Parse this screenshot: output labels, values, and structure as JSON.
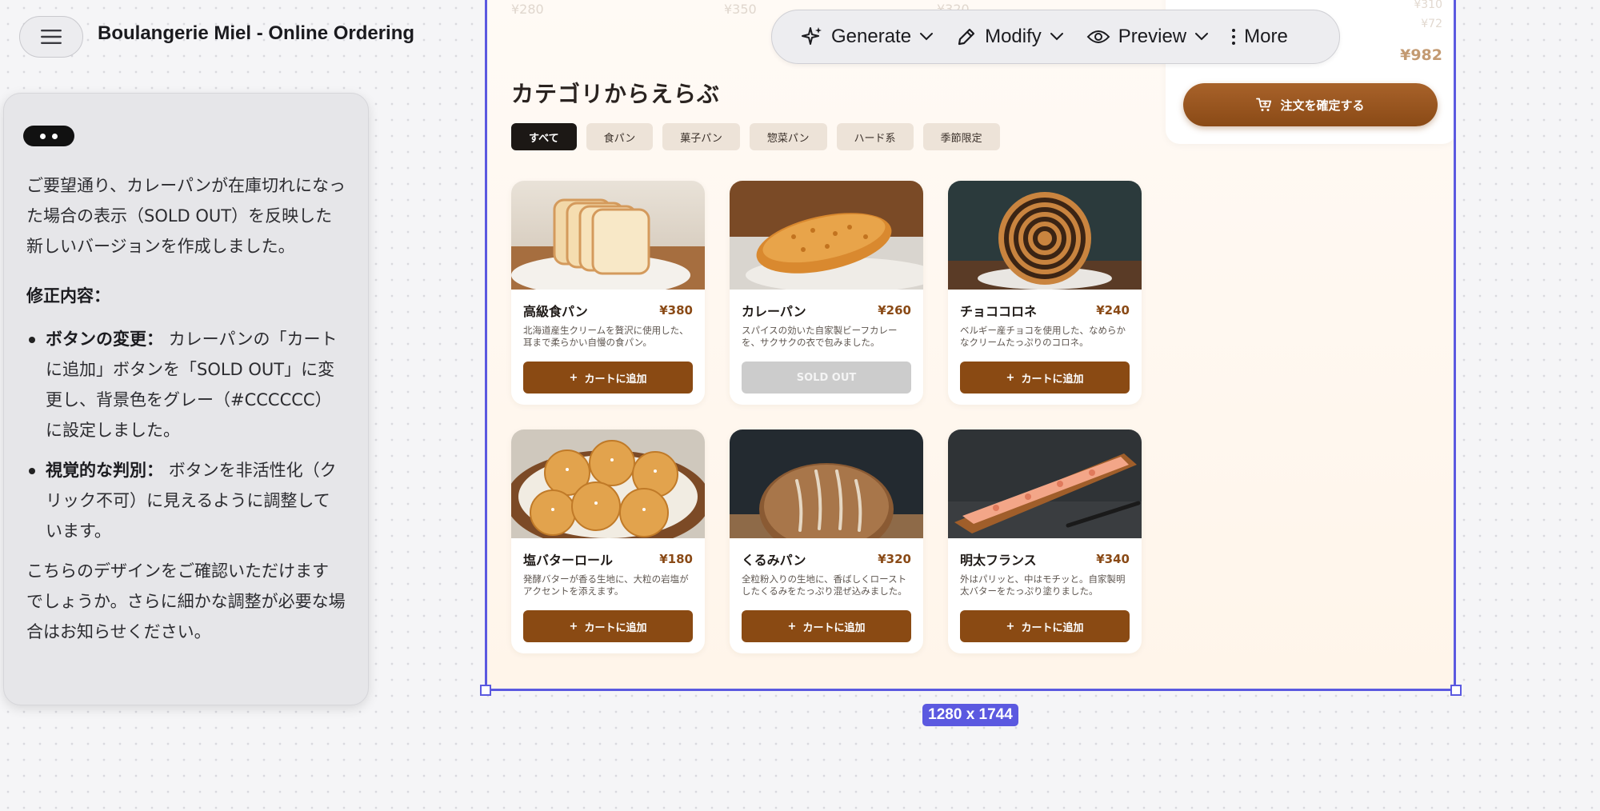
{
  "app": {
    "title": "Boulangerie Miel - Online Ordering"
  },
  "chat": {
    "intro": "ご要望通り、カレーパンが在庫切れになった場合の表示（SOLD OUT）を反映した新しいバージョンを作成しました。",
    "heading": "修正内容：",
    "bullets": [
      {
        "title": "ボタンの変更：",
        "text": "カレーパンの「カートに追加」ボタンを「SOLD OUT」に変更し、背景色をグレー（#CCCCCC）に設定しました。"
      },
      {
        "title": "視覚的な判別：",
        "text": "ボタンを非活性化（クリック不可）に見えるように調整しています。"
      }
    ],
    "closing": "こちらのデザインをご確認いただけますでしょうか。さらに細かな調整が必要な場合はお知らせください。"
  },
  "toolbar": {
    "generate": "Generate",
    "modify": "Modify",
    "preview": "Preview",
    "more": "More"
  },
  "frame": {
    "size_label": "1280 x 1744",
    "ghost_prices": [
      "¥280",
      "¥350",
      "¥320"
    ],
    "order": {
      "ghost_top": "¥310",
      "ghost_line": "¥72",
      "total": "¥982",
      "confirm_label": "注文を確定する"
    }
  },
  "category": {
    "title": "カテゴリからえらぶ",
    "chips": [
      "すべて",
      "食パン",
      "菓子パン",
      "惣菜パン",
      "ハード系",
      "季節限定"
    ],
    "active_index": 0
  },
  "products": [
    {
      "name": "高級食パン",
      "price": "¥380",
      "desc": "北海道産生クリームを贅沢に使用した、耳まで柔らかい自慢の食パン。",
      "button": "カートに追加",
      "sold_out": false
    },
    {
      "name": "カレーパン",
      "price": "¥260",
      "desc": "スパイスの効いた自家製ビーフカレーを、サクサクの衣で包みました。",
      "button": "SOLD OUT",
      "sold_out": true
    },
    {
      "name": "チョココロネ",
      "price": "¥240",
      "desc": "ベルギー産チョコを使用した、なめらかなクリームたっぷりのコロネ。",
      "button": "カートに追加",
      "sold_out": false
    },
    {
      "name": "塩バターロール",
      "price": "¥180",
      "desc": "発酵バターが香る生地に、大粒の岩塩がアクセントを添えます。",
      "button": "カートに追加",
      "sold_out": false
    },
    {
      "name": "くるみパン",
      "price": "¥320",
      "desc": "全粒粉入りの生地に、香ばしくローストしたくるみをたっぷり混ぜ込みました。",
      "button": "カートに追加",
      "sold_out": false
    },
    {
      "name": "明太フランス",
      "price": "¥340",
      "desc": "外はパリッと、中はモチッと。自家製明太バターをたっぷり塗りました。",
      "button": "カートに追加",
      "sold_out": false
    }
  ],
  "colors": {
    "accent": "#8a4a13",
    "sold_out": "#CCCCCC",
    "selection": "#5b59e0"
  }
}
